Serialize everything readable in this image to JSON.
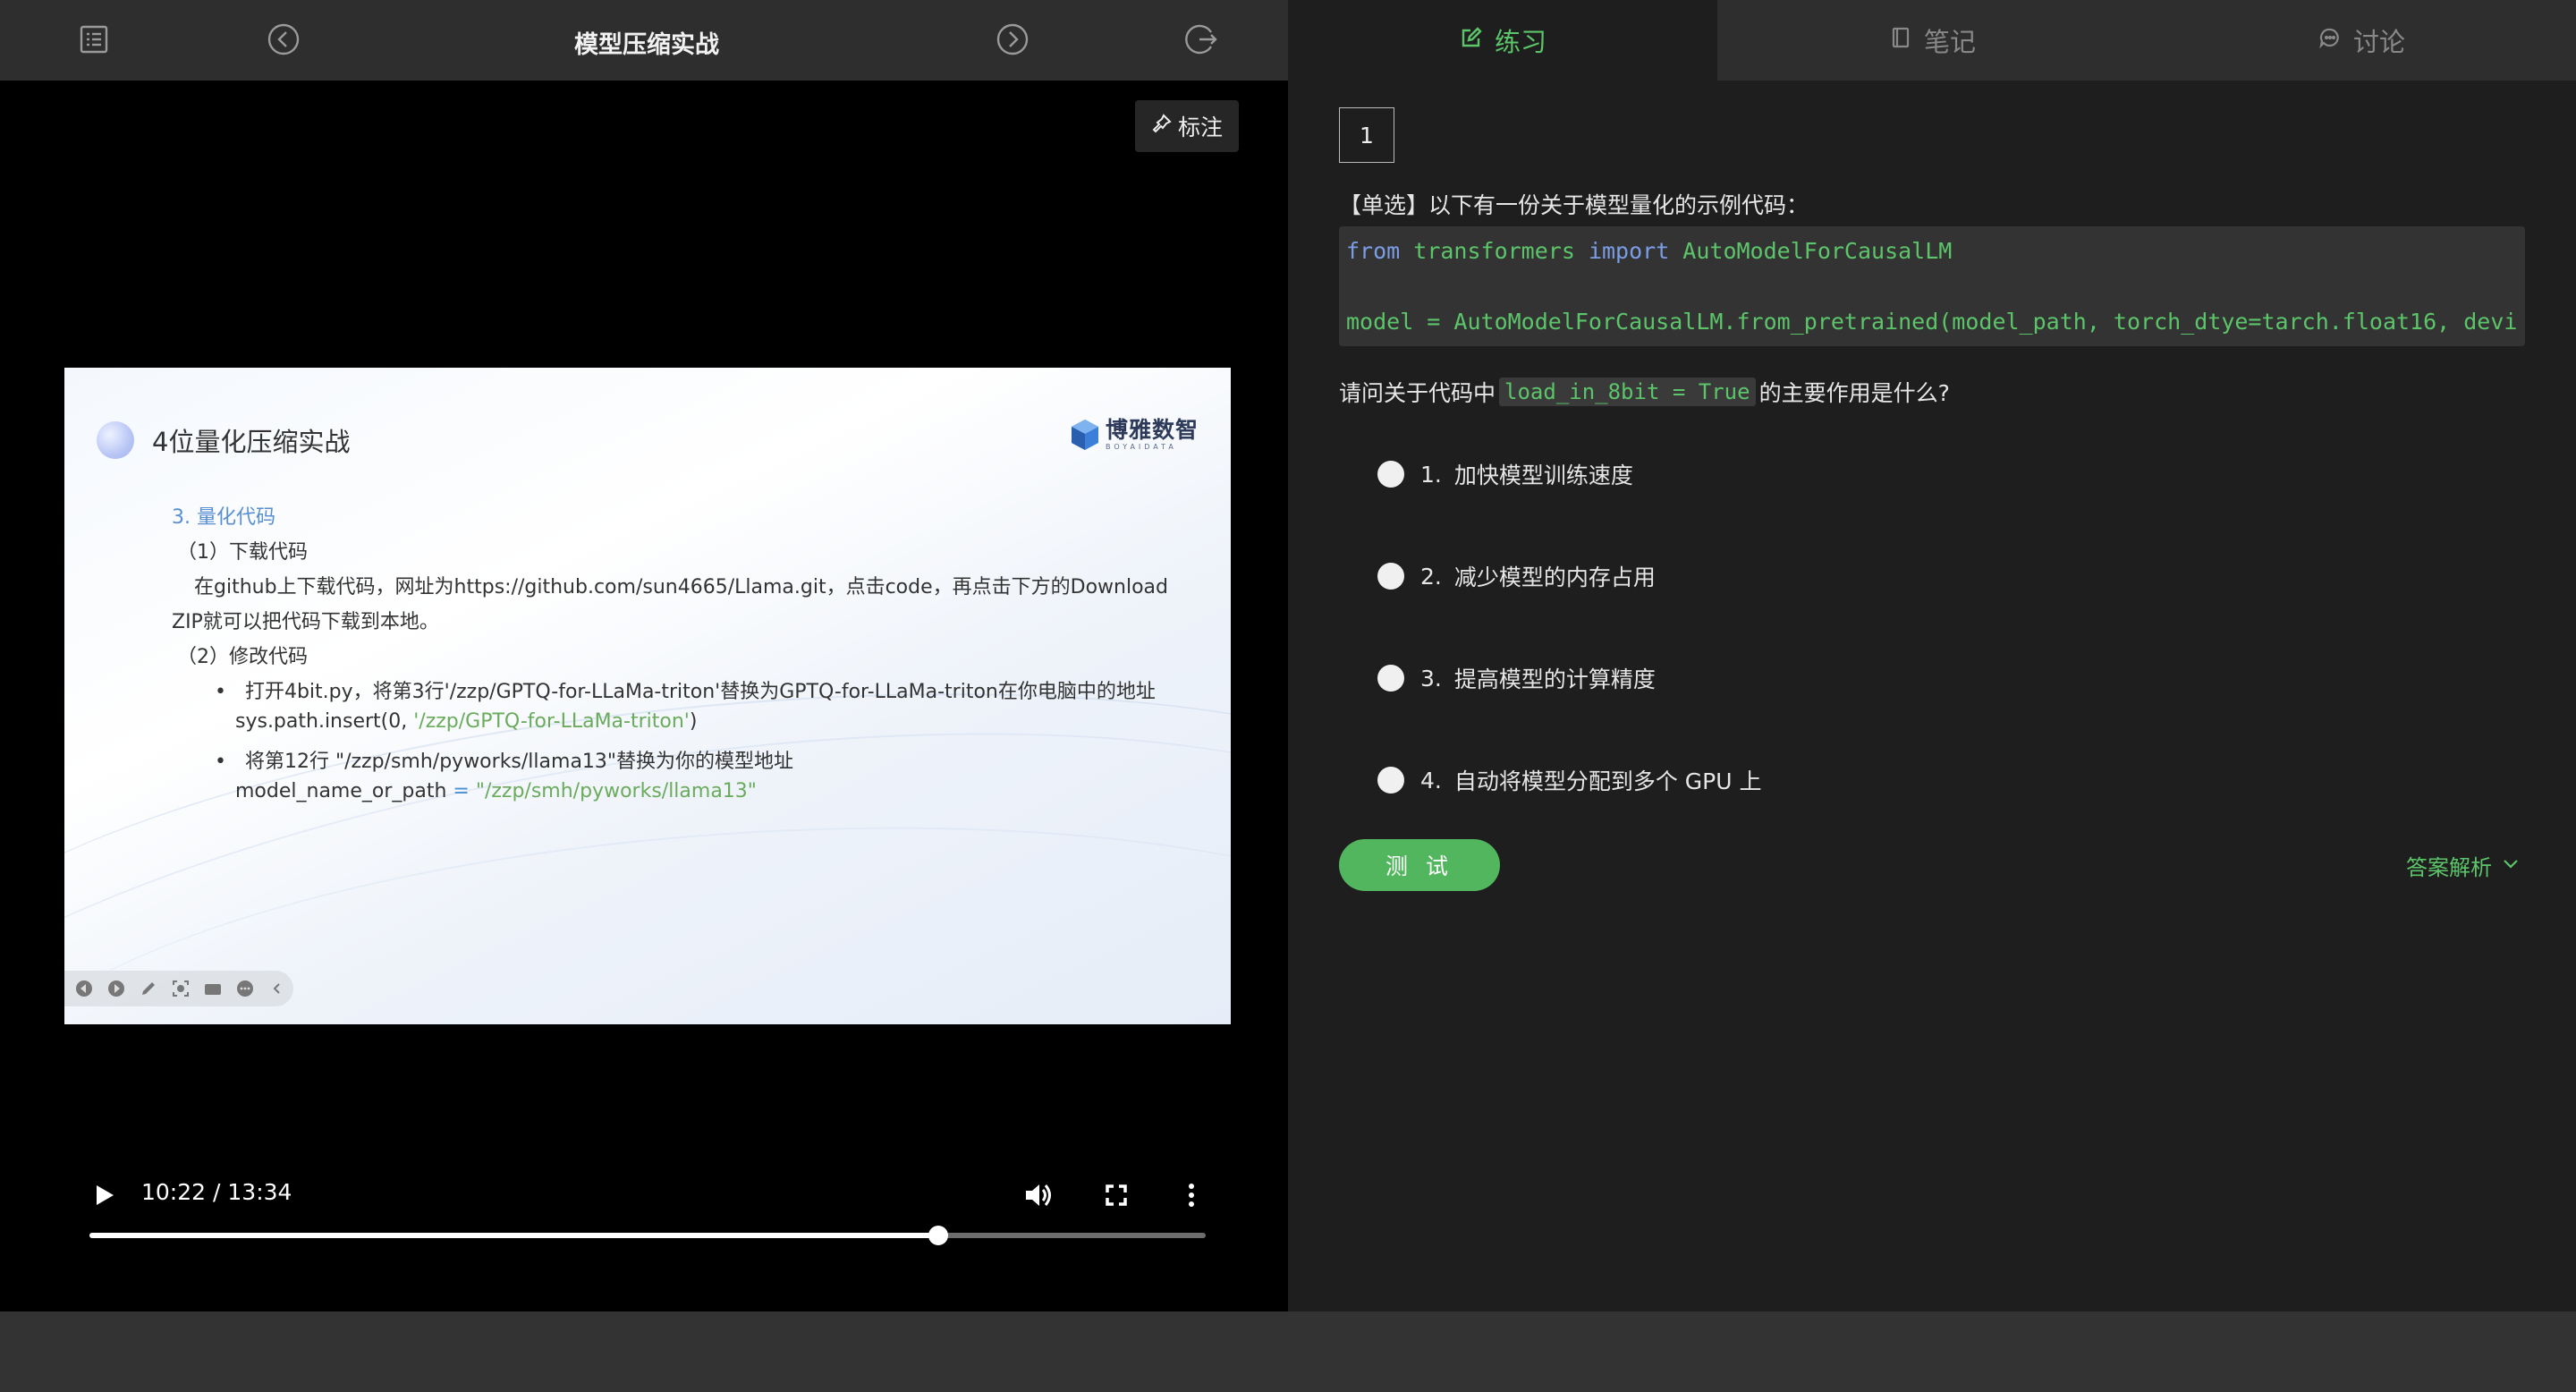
{
  "header": {
    "title": "模型压缩实战",
    "icons": [
      "catalog-icon",
      "previous-icon",
      "next-icon",
      "exit-icon"
    ]
  },
  "video": {
    "mark_label": "标注",
    "current_time": "10:22",
    "time_separator": "/",
    "duration": "13:34",
    "progress": 0.7605
  },
  "slide": {
    "heading": "4位量化压缩实战",
    "logo_text": "博雅数智",
    "logo_sub": "BOYAIDATA",
    "section": "3. 量化代码",
    "step1": "（1）下载代码",
    "step1_text_a": "在github上下载代码，网址为https://github.com/sun4665/Llama.git，点击code，再点击下方的Download",
    "step1_text_b": "ZIP就可以把代码下载到本地。",
    "step2": "（2）修改代码",
    "bullet1": "打开4bit.py，将第3行'/zzp/GPTQ-for-LLaMa-triton'替换为GPTQ-for-LLaMa-triton在你电脑中的地址",
    "bullet1_code_a": "sys.path.insert(0, ",
    "bullet1_code_str": "'/zzp/GPTQ-for-LLaMa-triton'",
    "bullet1_code_b": ")",
    "bullet2": "将第12行 \"/zzp/smh/pyworks/llama13\"替换为你的模型地址",
    "bullet2_code_a": "model_name_or_path",
    "bullet2_code_eq": " = ",
    "bullet2_code_str": "\"/zzp/smh/pyworks/llama13\""
  },
  "tabs": [
    {
      "label": "练习",
      "icon": "edit-icon",
      "active": true
    },
    {
      "label": "笔记",
      "icon": "notebook-icon",
      "active": false
    },
    {
      "label": "讨论",
      "icon": "chat-icon",
      "active": false
    }
  ],
  "question": {
    "number": "1",
    "title": "【单选】以下有一份关于模型量化的示例代码：",
    "code_kw1": "from",
    "code_mod": " transformers ",
    "code_kw2": "import",
    "code_cls": " AutoModelForCausalLM",
    "code_line2": "model = AutoModelForCausalLM.from_pretrained(model_path, torch_dtye=tarch.float16, devi",
    "prompt_before": "请问关于代码中",
    "prompt_code": "load_in_8bit = True",
    "prompt_after": "的主要作用是什么?",
    "options": [
      {
        "num": "1.",
        "text": "加快模型训练速度"
      },
      {
        "num": "2.",
        "text": "减少模型的内存占用"
      },
      {
        "num": "3.",
        "text": "提高模型的计算精度"
      },
      {
        "num": "4.",
        "text": "自动将模型分配到多个 GPU 上"
      }
    ],
    "test_button": "测 试",
    "answer_link": "答案解析"
  },
  "colors": {
    "accent_green": "#5cc56a",
    "button_green": "#52b65e",
    "keyword_blue": "#7b9de6"
  }
}
